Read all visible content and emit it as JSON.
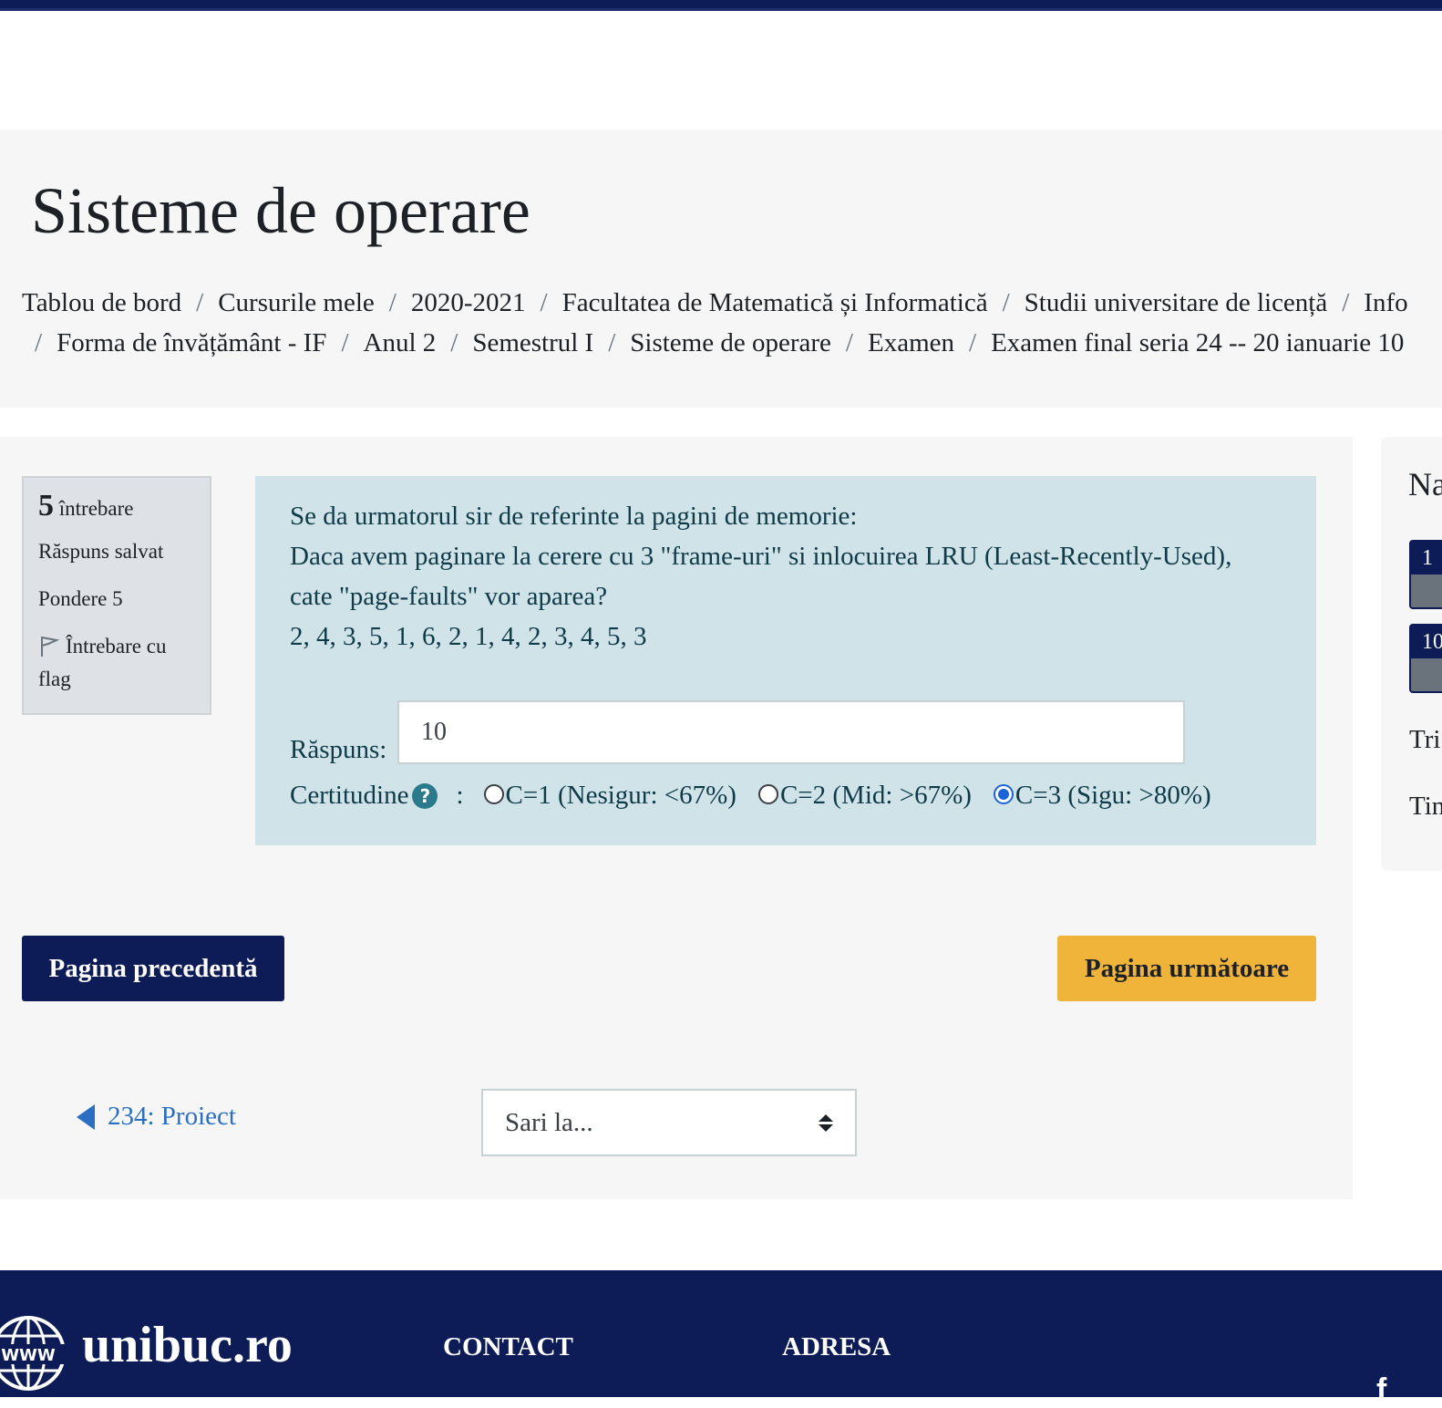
{
  "page": {
    "title": "Sisteme de operare"
  },
  "breadcrumb": {
    "row1": [
      "Tablou de bord",
      "Cursurile mele",
      "2020-2021",
      "Facultatea de Matematică și Informatică",
      "Studii universitare de licență",
      "Info"
    ],
    "row2": [
      "Forma de învățământ - IF",
      "Anul 2",
      "Semestrul I",
      "Sisteme de operare",
      "Examen",
      "Examen final seria 24 -- 20 ianuarie 10"
    ],
    "separator": "/"
  },
  "question_info": {
    "number": "5",
    "label": "întrebare",
    "status": "Răspuns salvat",
    "weight": "Pondere 5",
    "flag_label_1": "Întrebare cu",
    "flag_label_2": "flag"
  },
  "question": {
    "line1": "Se da urmatorul sir de referinte la pagini de memorie:",
    "line2": "Daca avem paginare la cerere cu 3 \"frame-uri\" si inlocuirea LRU (Least-Recently-Used),",
    "line3": "cate \"page-faults\" vor aparea?",
    "sequence": "2, 4, 3, 5, 1, 6, 2, 1, 4, 2, 3, 4, 5, 3",
    "answer_label": "Răspuns:",
    "answer_value": "10",
    "certainty_label": "Certitudine",
    "certainty_colon": ":",
    "options": [
      {
        "label": "C=1 (Nesigur: <67%)",
        "checked": false
      },
      {
        "label": "C=2 (Mid: >67%)",
        "checked": false
      },
      {
        "label": "C=3 (Sigu: >80%)",
        "checked": true
      }
    ]
  },
  "buttons": {
    "prev": "Pagina precedentă",
    "next": "Pagina următoare"
  },
  "navigation": {
    "prev_activity": "234: Proiect",
    "jump_placeholder": "Sari la..."
  },
  "quiz_nav": {
    "title_partial": "Na",
    "btn1": "1",
    "btn2": "10",
    "line1_partial": "Tri",
    "line2_partial": "Tin"
  },
  "footer": {
    "brand": "unibuc.ro",
    "globe_text": "WWW",
    "contact": "CONTACT",
    "adresa": "ADRESA",
    "social": "f"
  },
  "colors": {
    "brand_navy": "#0d1c56",
    "accent_yellow": "#f0b43a",
    "question_bg": "#cfe3e8",
    "link_blue": "#2b6fc2",
    "radio_checked": "#1a64d8"
  }
}
